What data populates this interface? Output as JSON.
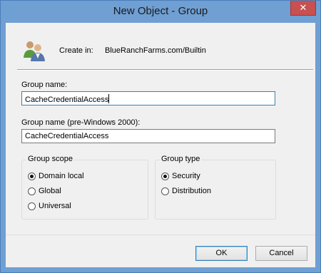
{
  "window": {
    "title": "New Object - Group",
    "close_glyph": "✕"
  },
  "header": {
    "icon": "users-icon",
    "create_in_label": "Create in:",
    "create_in_value": "BlueRanchFarms.com/Builtin"
  },
  "fields": {
    "group_name": {
      "label": "Group name:",
      "value": "CacheCredentialAccess"
    },
    "group_name_pre2000": {
      "label": "Group name (pre-Windows 2000):",
      "value": "CacheCredentialAccess"
    }
  },
  "group_scope": {
    "title": "Group scope",
    "options": [
      {
        "label": "Domain local",
        "checked": true
      },
      {
        "label": "Global",
        "checked": false
      },
      {
        "label": "Universal",
        "checked": false
      }
    ]
  },
  "group_type": {
    "title": "Group type",
    "options": [
      {
        "label": "Security",
        "checked": true
      },
      {
        "label": "Distribution",
        "checked": false
      }
    ]
  },
  "buttons": {
    "ok": "OK",
    "cancel": "Cancel"
  }
}
